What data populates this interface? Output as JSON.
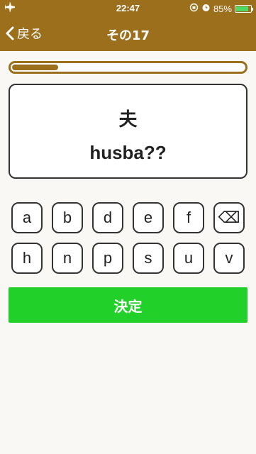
{
  "status": {
    "time": "22:47",
    "battery": "85%",
    "battery_level": 0.85,
    "airplane_icon": "airplane-icon",
    "icons": [
      "rotation-lock-icon",
      "alarm-icon"
    ]
  },
  "nav": {
    "back_label": "戻る",
    "title": "その17"
  },
  "progress": {
    "value": 0.2
  },
  "question": {
    "kanji": "夫",
    "answer": "husba??"
  },
  "keys": [
    "a",
    "b",
    "d",
    "e",
    "f",
    "⌫",
    "h",
    "n",
    "p",
    "s",
    "u",
    "v"
  ],
  "submit_label": "決定",
  "colors": {
    "bar": "#9c6f1d",
    "submit": "#22d02a"
  }
}
